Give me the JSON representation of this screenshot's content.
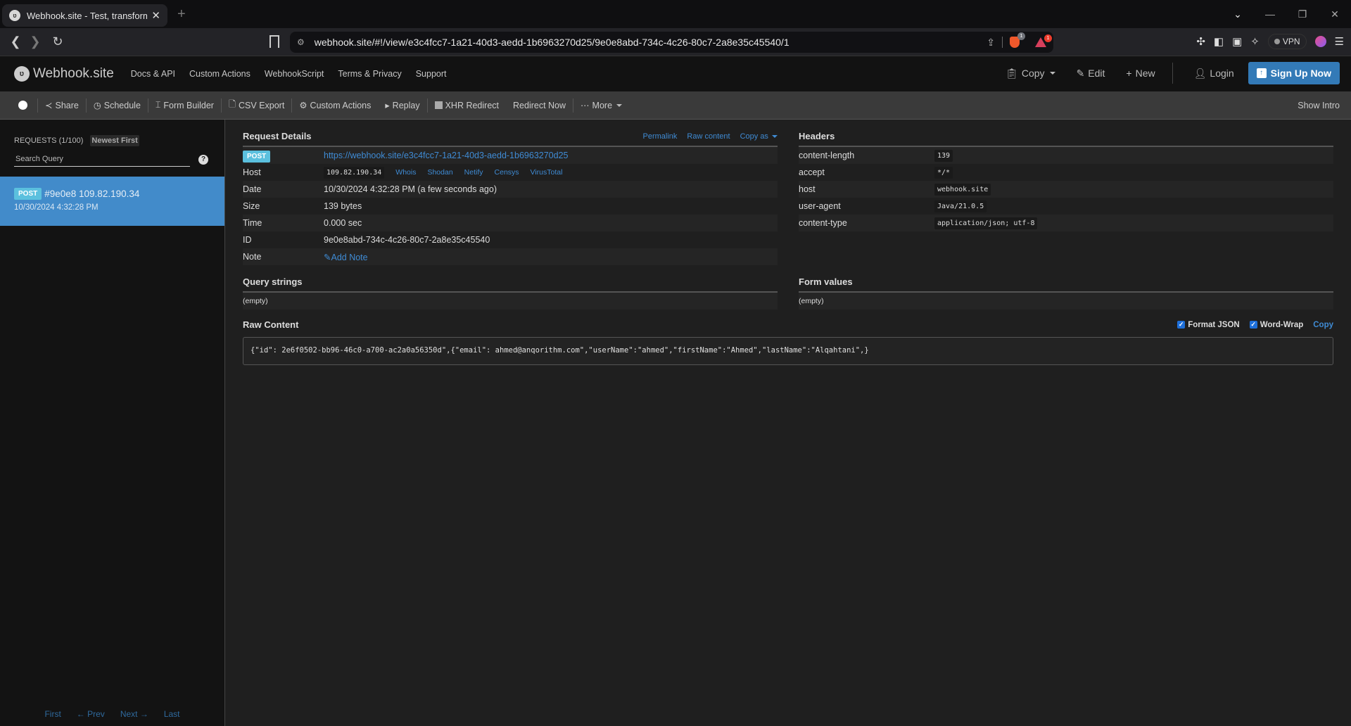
{
  "browser": {
    "tab_title": "Webhook.site - Test, transform",
    "url": "webhook.site/#!/view/e3c4fcc7-1a21-40d3-aedd-1b6963270d25/9e0e8abd-734c-4c26-80c7-2a8e35c45540/1",
    "shield_badge": "1",
    "rewards_badge": "1",
    "vpn_label": "VPN"
  },
  "site": {
    "logo": "Webhook.site",
    "nav": [
      "Docs & API",
      "Custom Actions",
      "WebhookScript",
      "Terms & Privacy",
      "Support"
    ],
    "header_actions": {
      "copy": "Copy",
      "edit": "Edit",
      "new": "New",
      "login": "Login",
      "signup": "Sign Up Now"
    }
  },
  "toolbar": {
    "items": {
      "share": "Share",
      "schedule": "Schedule",
      "form_builder": "Form Builder",
      "csv_export": "CSV Export",
      "custom_actions": "Custom Actions",
      "replay": "Replay",
      "xhr_redirect": "XHR Redirect",
      "redirect_now": "Redirect Now",
      "more": "More"
    },
    "show_intro": "Show Intro"
  },
  "sidebar": {
    "title": "REQUESTS (1/100)",
    "sort": "Newest First",
    "search_placeholder": "Search Query",
    "help": "?",
    "requests": [
      {
        "method": "POST",
        "summary": "#9e0e8 109.82.190.34",
        "timestamp": "10/30/2024 4:32:28 PM"
      }
    ],
    "pager": {
      "first": "First",
      "prev": "← Prev",
      "next": "Next →",
      "last": "Last"
    }
  },
  "request_details": {
    "title": "Request Details",
    "links": {
      "permalink": "Permalink",
      "raw": "Raw content",
      "copy_as": "Copy as"
    },
    "method": "POST",
    "url": "https://webhook.site/e3c4fcc7-1a21-40d3-aedd-1b6963270d25",
    "host_label": "Host",
    "host": "109.82.190.34",
    "host_links": [
      "Whois",
      "Shodan",
      "Netify",
      "Censys",
      "VirusTotal"
    ],
    "date_label": "Date",
    "date": "10/30/2024 4:32:28 PM (a few seconds ago)",
    "size_label": "Size",
    "size": "139 bytes",
    "time_label": "Time",
    "time": "0.000 sec",
    "id_label": "ID",
    "id": "9e0e8abd-734c-4c26-80c7-2a8e35c45540",
    "note_label": "Note",
    "add_note": "Add Note"
  },
  "headers": {
    "title": "Headers",
    "rows": [
      {
        "key": "content-length",
        "value": "139"
      },
      {
        "key": "accept",
        "value": "*/*"
      },
      {
        "key": "host",
        "value": "webhook.site"
      },
      {
        "key": "user-agent",
        "value": "Java/21.0.5"
      },
      {
        "key": "content-type",
        "value": "application/json; utf-8"
      }
    ]
  },
  "query_strings": {
    "title": "Query strings",
    "value": "(empty)"
  },
  "form_values": {
    "title": "Form values",
    "value": "(empty)"
  },
  "raw_content": {
    "title": "Raw Content",
    "format_json": "Format JSON",
    "format_json_checked": true,
    "word_wrap": "Word-Wrap",
    "word_wrap_checked": true,
    "copy": "Copy",
    "body": "{\"id\": 2e6f0502-bb96-46c0-a700-ac2a0a56350d\",{\"email\": ahmed@anqorithm.com\",\"userName\":\"ahmed\",\"firstName\":\"Ahmed\",\"lastName\":\"Alqahtani\",}"
  }
}
